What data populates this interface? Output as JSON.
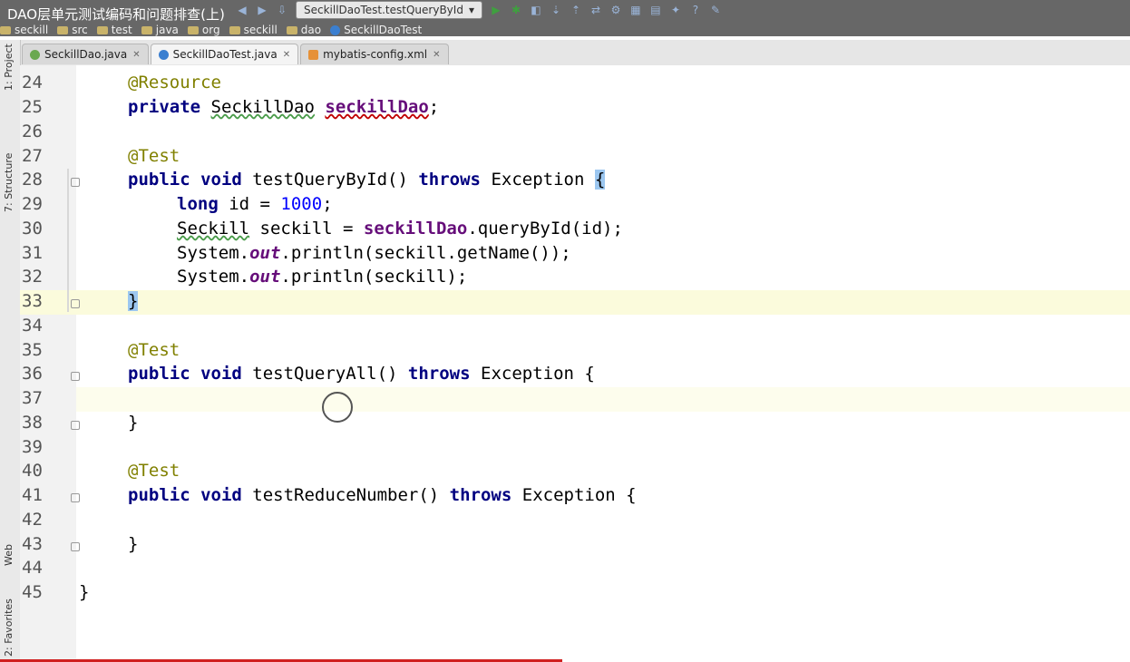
{
  "video_title": "DAO层单元测试编码和问题排查(上)",
  "toolbar": {
    "run_config": "SeckillDaoTest.testQueryById"
  },
  "breadcrumb": [
    "seckill",
    "src",
    "test",
    "java",
    "org",
    "seckill",
    "dao",
    "SeckillDaoTest"
  ],
  "tabs": [
    {
      "label": "SeckillDao.java",
      "color": "#6aa84f"
    },
    {
      "label": "SeckillDaoTest.java",
      "color": "#3b7fd0"
    },
    {
      "label": "mybatis-config.xml",
      "color": "#e69138"
    }
  ],
  "side_tabs": {
    "project": "1: Project",
    "structure": "7: Structure",
    "web": "Web",
    "favorites": "2: Favorites"
  },
  "line_numbers": [
    "24",
    "25",
    "26",
    "27",
    "28",
    "29",
    "30",
    "31",
    "32",
    "33",
    "34",
    "35",
    "36",
    "37",
    "38",
    "39",
    "40",
    "41",
    "42",
    "43",
    "44",
    "45"
  ],
  "code": {
    "l24_ann": "@Resource",
    "l25_kw": "private",
    "l25_type": "SeckillDao",
    "l25_field": "seckillDao",
    "l25_semi": ";",
    "l27_ann": "@Test",
    "l28_kw": "public void",
    "l28_name": "testQueryById()",
    "l28_throws": "throws",
    "l28_exc": "Exception",
    "l28_brace": "{",
    "l29_kw": "long",
    "l29_rest": "id = ",
    "l29_num": "1000",
    "l29_semi": ";",
    "l30_type": "Seckill",
    "l30_rest": "seckill = ",
    "l30_field": "seckillDao",
    "l30_call": ".queryById(id);",
    "l31_sys": "System.",
    "l31_out": "out",
    "l31_rest": ".println(seckill.getName());",
    "l32_sys": "System.",
    "l32_out": "out",
    "l32_rest": ".println(seckill);",
    "l33_brace": "}",
    "l35_ann": "@Test",
    "l36_kw": "public void",
    "l36_name": "testQueryAll()",
    "l36_throws": "throws",
    "l36_exc": "Exception {",
    "l38_brace": "}",
    "l40_ann": "@Test",
    "l41_kw": "public void",
    "l41_name": "testReduceNumber()",
    "l41_throws": "throws",
    "l41_exc": "Exception {",
    "l43_brace": "}",
    "l45_brace": "}"
  }
}
